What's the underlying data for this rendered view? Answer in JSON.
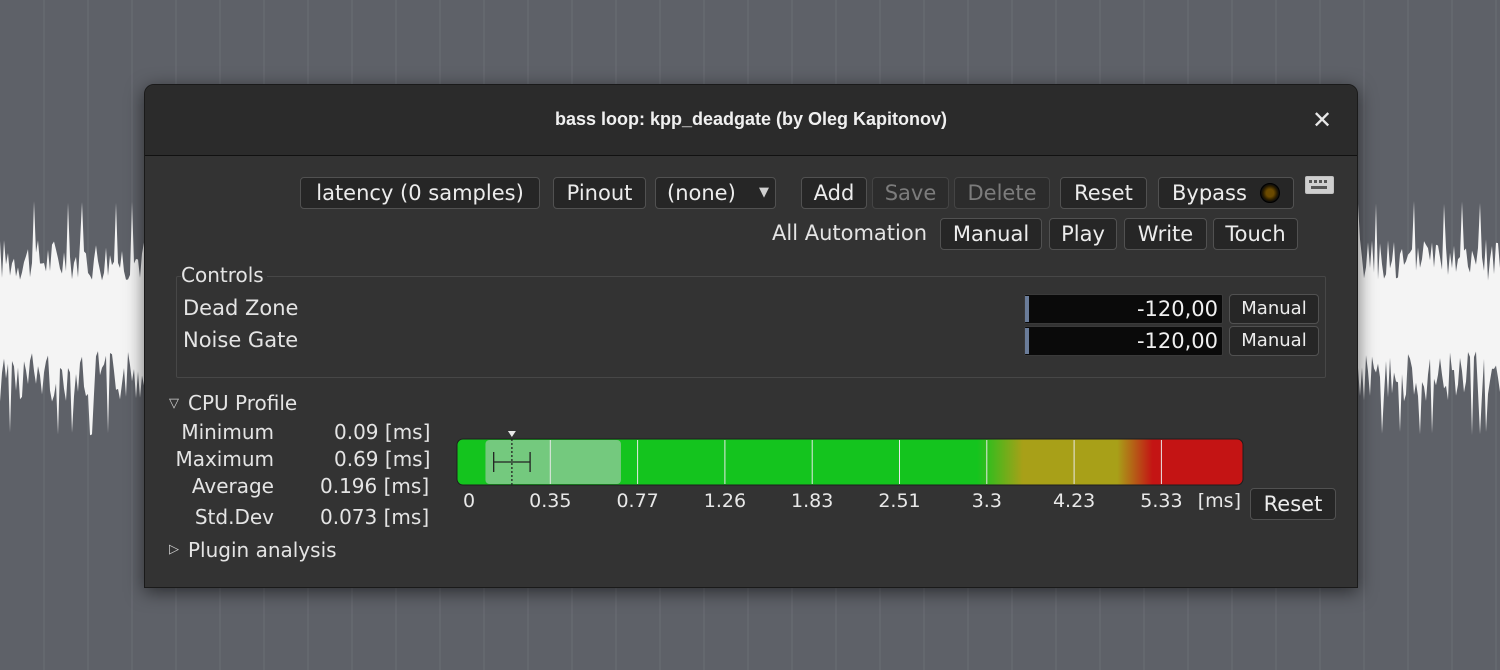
{
  "window": {
    "title": "bass loop: kpp_deadgate (by Oleg Kapitonov)"
  },
  "toolbar": {
    "latency_label": "latency (0 samples)",
    "pinout_label": "Pinout",
    "preset_value": "(none)",
    "add_label": "Add",
    "save_label": "Save",
    "delete_label": "Delete",
    "reset_label": "Reset",
    "bypass_label": "Bypass"
  },
  "automation": {
    "label": "All Automation",
    "manual_label": "Manual",
    "play_label": "Play",
    "write_label": "Write",
    "touch_label": "Touch"
  },
  "controls": {
    "title": "Controls",
    "items": [
      {
        "name": "Dead Zone",
        "value": "-120,00",
        "mode": "Manual"
      },
      {
        "name": "Noise Gate",
        "value": "-120,00",
        "mode": "Manual"
      }
    ]
  },
  "cpu_profile": {
    "title": "CPU Profile",
    "stats": [
      {
        "name": "Minimum",
        "value": "0.09 [ms]"
      },
      {
        "name": "Maximum",
        "value": "0.69 [ms]"
      },
      {
        "name": "Average",
        "value": "0.196 [ms]"
      },
      {
        "name": "Std.Dev",
        "value": "0.073 [ms]"
      }
    ],
    "min_ms": 0.09,
    "max_ms": 0.69,
    "avg_ms": 0.196,
    "stddev_ms": 0.073,
    "ticks": [
      "0",
      "0.35",
      "0.77",
      "1.26",
      "1.83",
      "2.51",
      "3.3",
      "4.23",
      "5.33"
    ],
    "unit_label": "[ms]",
    "reset_label": "Reset"
  },
  "plugin_analysis": {
    "title": "Plugin analysis"
  },
  "colors": {
    "meter_green": "#14c41e",
    "meter_yellow": "#a8a018",
    "meter_red": "#c41414",
    "range_highlight": "#74c97e"
  }
}
